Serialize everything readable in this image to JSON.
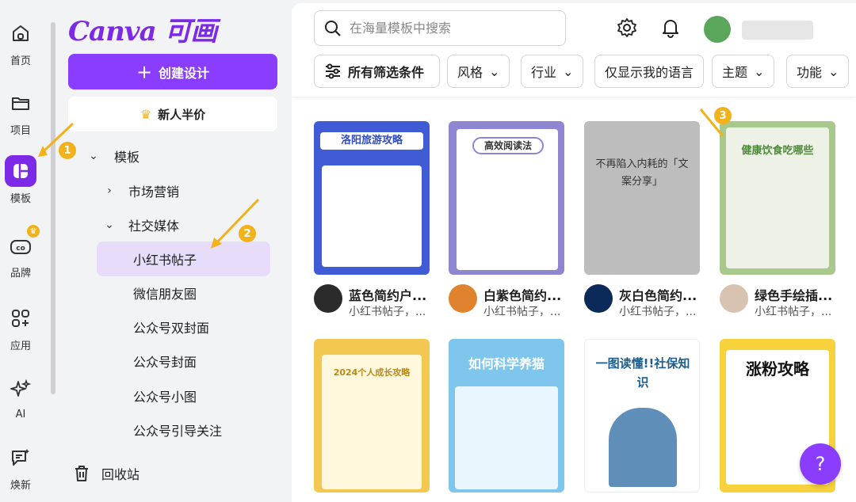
{
  "rail": {
    "items": [
      {
        "label": "首页",
        "icon": "home-icon"
      },
      {
        "label": "项目",
        "icon": "folder-icon"
      },
      {
        "label": "模板",
        "icon": "template-icon"
      },
      {
        "label": "品牌",
        "icon": "brand-icon"
      },
      {
        "label": "应用",
        "icon": "apps-icon"
      },
      {
        "label": "AI",
        "icon": "sparkle-icon"
      },
      {
        "label": "焕新",
        "icon": "whats-new-icon"
      }
    ]
  },
  "panel": {
    "logo": "Canva 可画",
    "create_label": "创建设计",
    "promo_label": "新人半价",
    "tree": [
      {
        "label": "模板",
        "level": 0,
        "expanded": true
      },
      {
        "label": "市场营销",
        "level": 1,
        "expanded": false
      },
      {
        "label": "社交媒体",
        "level": 1,
        "expanded": true
      },
      {
        "label": "小红书帖子",
        "level": 2,
        "selected": true
      },
      {
        "label": "微信朋友圈",
        "level": 2
      },
      {
        "label": "公众号双封面",
        "level": 2
      },
      {
        "label": "公众号封面",
        "level": 2
      },
      {
        "label": "公众号小图",
        "level": 2
      },
      {
        "label": "公众号引导关注",
        "level": 2
      }
    ],
    "trash_label": "回收站"
  },
  "header": {
    "search_placeholder": "在海量模板中搜索"
  },
  "filters": {
    "all_label": "所有筛选条件",
    "chips": [
      "风格",
      "行业",
      "仅显示我的语言",
      "主题",
      "功能"
    ]
  },
  "templates": [
    {
      "title": "蓝色简约户...",
      "subtitle": "小红书帖子，...",
      "thumb_text": "洛阳旅游攻略",
      "color": "#3f5bd6"
    },
    {
      "title": "白紫色简约...",
      "subtitle": "小红书帖子，...",
      "thumb_text": "高效阅读法",
      "color": "#8e86d1"
    },
    {
      "title": "灰白色简约...",
      "subtitle": "小红书帖子，...",
      "thumb_text": "不再陷入内耗的「文案分享」",
      "color": "#bdbdbd"
    },
    {
      "title": "绿色手绘插...",
      "subtitle": "小红书帖子，...",
      "thumb_text": "健康饮食吃哪些",
      "color": "#a9c98c"
    },
    {
      "title": "",
      "subtitle": "",
      "thumb_text": "2024个人成长攻略",
      "color": "#f3c850"
    },
    {
      "title": "",
      "subtitle": "",
      "thumb_text": "如何科学养猫",
      "color": "#7ec6ec"
    },
    {
      "title": "",
      "subtitle": "",
      "thumb_text": "一图读懂!!社保知识",
      "color": "#ffffff"
    },
    {
      "title": "",
      "subtitle": "",
      "thumb_text": "涨粉攻略",
      "color": "#f7d23c"
    }
  ],
  "markers": [
    "1",
    "2",
    "3"
  ],
  "help_label": "?",
  "colors": {
    "accent": "#8b3dff",
    "marker": "#f2b21b",
    "selected_bg": "#e7dcfa"
  }
}
